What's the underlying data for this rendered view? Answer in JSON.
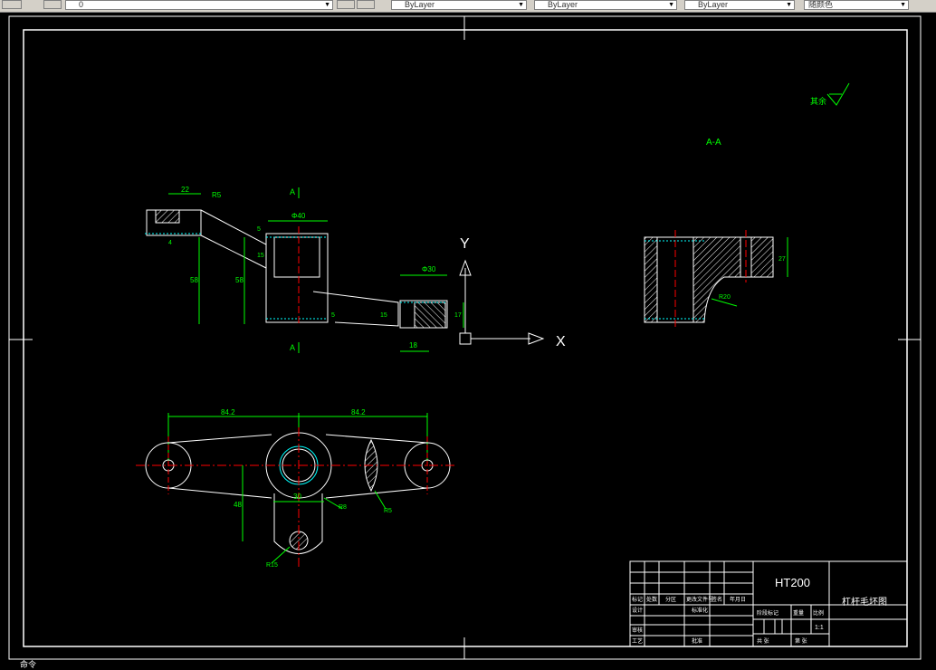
{
  "toolbar": {
    "layer_value": "0",
    "color_value": "ByLayer",
    "linetype_value": "ByLayer",
    "lineweight_value": "ByLayer",
    "plotstyle_value": "随颜色"
  },
  "drawing": {
    "section_label": "A-A",
    "section_mark_top": "A",
    "section_mark_bottom": "A",
    "roughness_note": "其余",
    "ucs_x": "X",
    "ucs_y": "Y",
    "dims": {
      "d22": "22",
      "r5_top": "R5",
      "d40": "Φ40",
      "d5": "5",
      "d15_a": "15",
      "d58_a": "58",
      "d58_b": "58",
      "d4": "4",
      "d30": "Φ30",
      "d17": "17",
      "d15_b": "15",
      "d5_b": "5",
      "d18": "18",
      "d27": "27",
      "r20": "R20",
      "d842_left": "84.2",
      "d842_right": "84.2",
      "d48": "48",
      "d30_bottom": "30",
      "r8": "R8",
      "r5_bottom": "R5",
      "r15": "R15"
    }
  },
  "title_block": {
    "material": "HT200",
    "part_name": "杠杆毛坯图",
    "scale": "1:1",
    "cells": {
      "mark": "标记",
      "count": "处数",
      "zone": "分区",
      "change_doc": "更改文件号",
      "signature": "签名",
      "date": "年月日",
      "design": "设计",
      "standardize": "标准化",
      "check": "审核",
      "process": "工艺",
      "approve": "批准",
      "stage_mark": "阶段标记",
      "weight": "重量",
      "ratio": "比例",
      "sheets_total": "共 张",
      "sheet_no": "第 张"
    }
  },
  "command_line": {
    "text": "命令"
  }
}
